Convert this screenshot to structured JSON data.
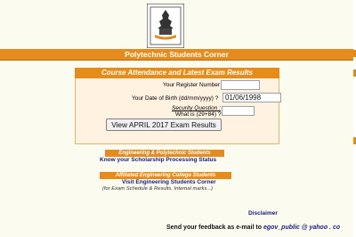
{
  "header": {
    "title": "Polytechnic Students Corner",
    "logo_icon": "tamilnadu-emblem-icon"
  },
  "panel": {
    "title": "Course Attendance and Latest Exam Results",
    "register_label": "Your Register Number ?",
    "register_value": "",
    "dob_label": "Your Date of Birth (dd/mm/yyyy) ?",
    "dob_value": "01/06/1998",
    "security_label": "Security Question :",
    "security_question": "What is (29+84) ?",
    "security_value": "",
    "submit_label": "View APRIL 2017 Exam Results"
  },
  "scholarship": {
    "tag": "Engineering & Polytechnic Students",
    "link": "Know your Scholarship Processing Status"
  },
  "affiliated": {
    "tag": "Affiliated Engineering College Students",
    "link": "Visit Engineering Students Corner",
    "note": "(for Exam Schedule & Results, Internal marks...)"
  },
  "footer": {
    "disclaimer": "Disclaimer",
    "feedback_prefix": "Send your feedback as e-mail to",
    "email": "egov_public @ yahoo . co"
  },
  "colors": {
    "accent": "#e58c1c",
    "panel_bg": "#fff2e0",
    "link": "#1a1a80",
    "page_bg": "#fbfbef"
  }
}
